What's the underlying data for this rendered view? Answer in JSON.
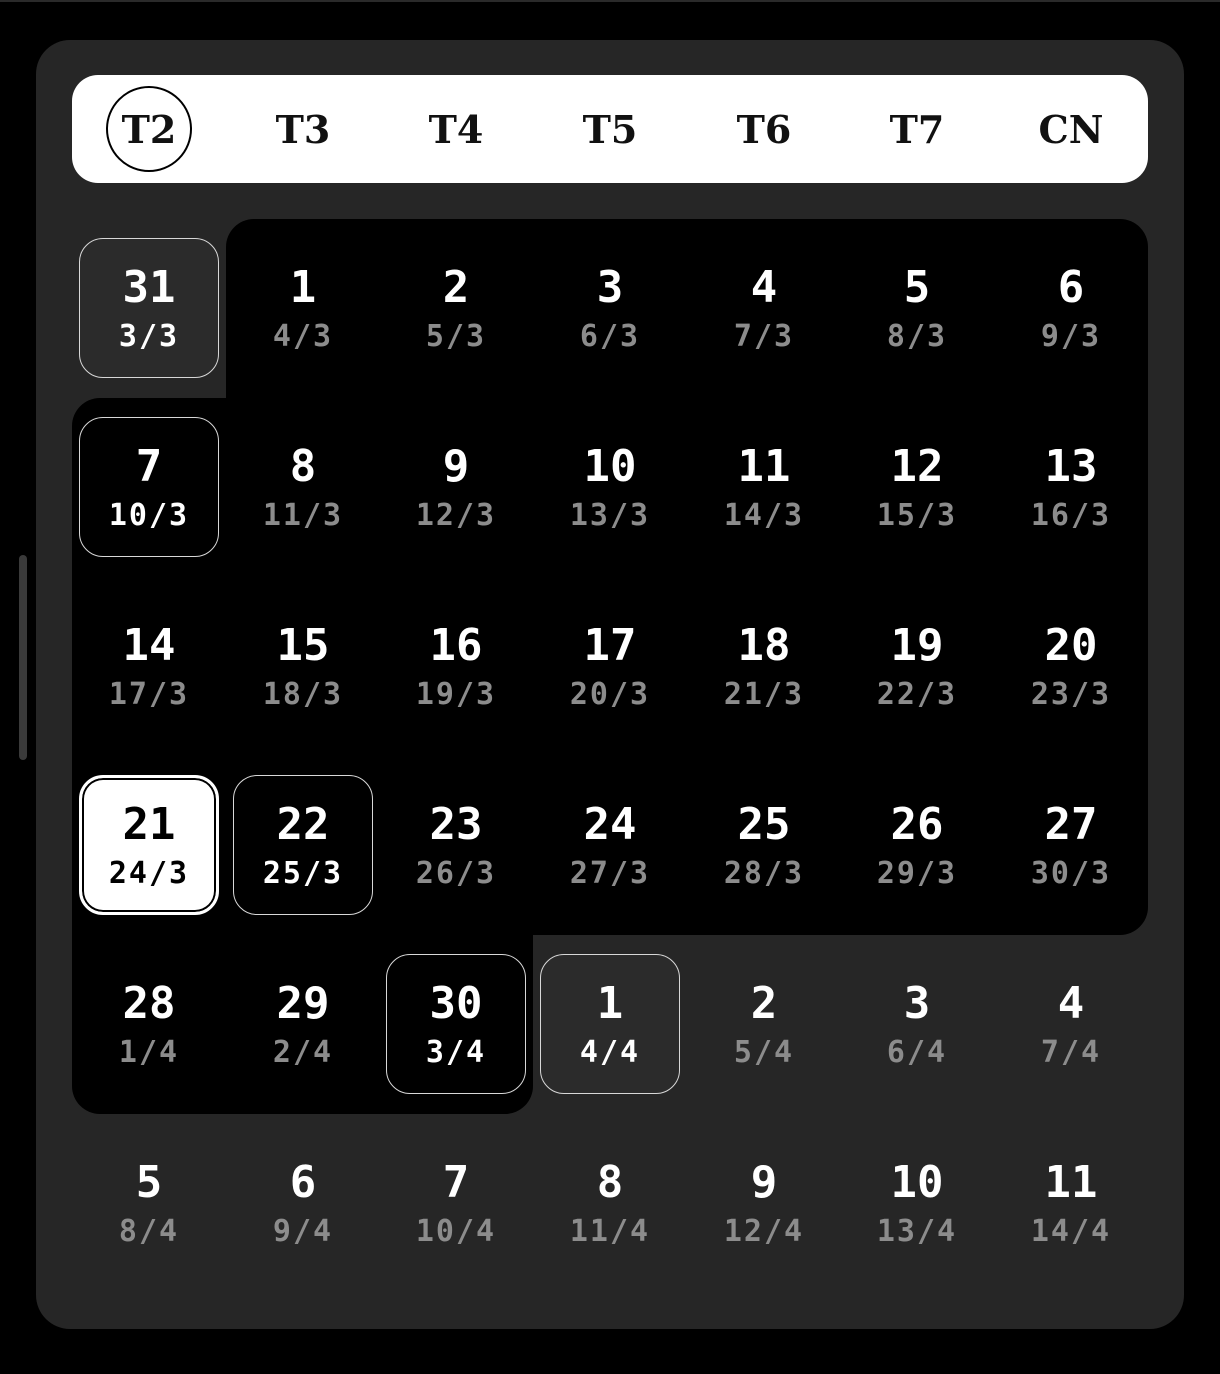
{
  "weekdays": [
    "T2",
    "T3",
    "T4",
    "T5",
    "T6",
    "T7",
    "CN"
  ],
  "selected_weekday": "T2",
  "weeks": [
    [
      {
        "day": "31",
        "lunar": "3/3",
        "state": "boxed-grey"
      },
      {
        "day": "1",
        "lunar": "4/3",
        "state": "normal"
      },
      {
        "day": "2",
        "lunar": "5/3",
        "state": "normal"
      },
      {
        "day": "3",
        "lunar": "6/3",
        "state": "normal"
      },
      {
        "day": "4",
        "lunar": "7/3",
        "state": "normal"
      },
      {
        "day": "5",
        "lunar": "8/3",
        "state": "normal"
      },
      {
        "day": "6",
        "lunar": "9/3",
        "state": "normal"
      }
    ],
    [
      {
        "day": "7",
        "lunar": "10/3",
        "state": "boxed-dark"
      },
      {
        "day": "8",
        "lunar": "11/3",
        "state": "normal"
      },
      {
        "day": "9",
        "lunar": "12/3",
        "state": "normal"
      },
      {
        "day": "10",
        "lunar": "13/3",
        "state": "normal"
      },
      {
        "day": "11",
        "lunar": "14/3",
        "state": "normal"
      },
      {
        "day": "12",
        "lunar": "15/3",
        "state": "normal"
      },
      {
        "day": "13",
        "lunar": "16/3",
        "state": "normal"
      }
    ],
    [
      {
        "day": "14",
        "lunar": "17/3",
        "state": "normal"
      },
      {
        "day": "15",
        "lunar": "18/3",
        "state": "normal"
      },
      {
        "day": "16",
        "lunar": "19/3",
        "state": "normal"
      },
      {
        "day": "17",
        "lunar": "20/3",
        "state": "normal"
      },
      {
        "day": "18",
        "lunar": "21/3",
        "state": "normal"
      },
      {
        "day": "19",
        "lunar": "22/3",
        "state": "normal"
      },
      {
        "day": "20",
        "lunar": "23/3",
        "state": "normal"
      }
    ],
    [
      {
        "day": "21",
        "lunar": "24/3",
        "state": "today"
      },
      {
        "day": "22",
        "lunar": "25/3",
        "state": "boxed-dark"
      },
      {
        "day": "23",
        "lunar": "26/3",
        "state": "normal"
      },
      {
        "day": "24",
        "lunar": "27/3",
        "state": "normal"
      },
      {
        "day": "25",
        "lunar": "28/3",
        "state": "normal"
      },
      {
        "day": "26",
        "lunar": "29/3",
        "state": "normal"
      },
      {
        "day": "27",
        "lunar": "30/3",
        "state": "normal"
      }
    ],
    [
      {
        "day": "28",
        "lunar": "1/4",
        "state": "normal"
      },
      {
        "day": "29",
        "lunar": "2/4",
        "state": "normal"
      },
      {
        "day": "30",
        "lunar": "3/4",
        "state": "boxed-dark"
      },
      {
        "day": "1",
        "lunar": "4/4",
        "state": "boxed-grey"
      },
      {
        "day": "2",
        "lunar": "5/4",
        "state": "normal"
      },
      {
        "day": "3",
        "lunar": "6/4",
        "state": "normal"
      },
      {
        "day": "4",
        "lunar": "7/4",
        "state": "normal"
      }
    ],
    [
      {
        "day": "5",
        "lunar": "8/4",
        "state": "normal"
      },
      {
        "day": "6",
        "lunar": "9/4",
        "state": "normal"
      },
      {
        "day": "7",
        "lunar": "10/4",
        "state": "normal"
      },
      {
        "day": "8",
        "lunar": "11/4",
        "state": "normal"
      },
      {
        "day": "9",
        "lunar": "12/4",
        "state": "normal"
      },
      {
        "day": "10",
        "lunar": "13/4",
        "state": "normal"
      },
      {
        "day": "11",
        "lunar": "14/4",
        "state": "normal"
      }
    ]
  ],
  "colors": {
    "background": "#000000",
    "panel": "#262626",
    "weekbar": "#ffffff",
    "lunar_text": "#8c8c8c"
  }
}
